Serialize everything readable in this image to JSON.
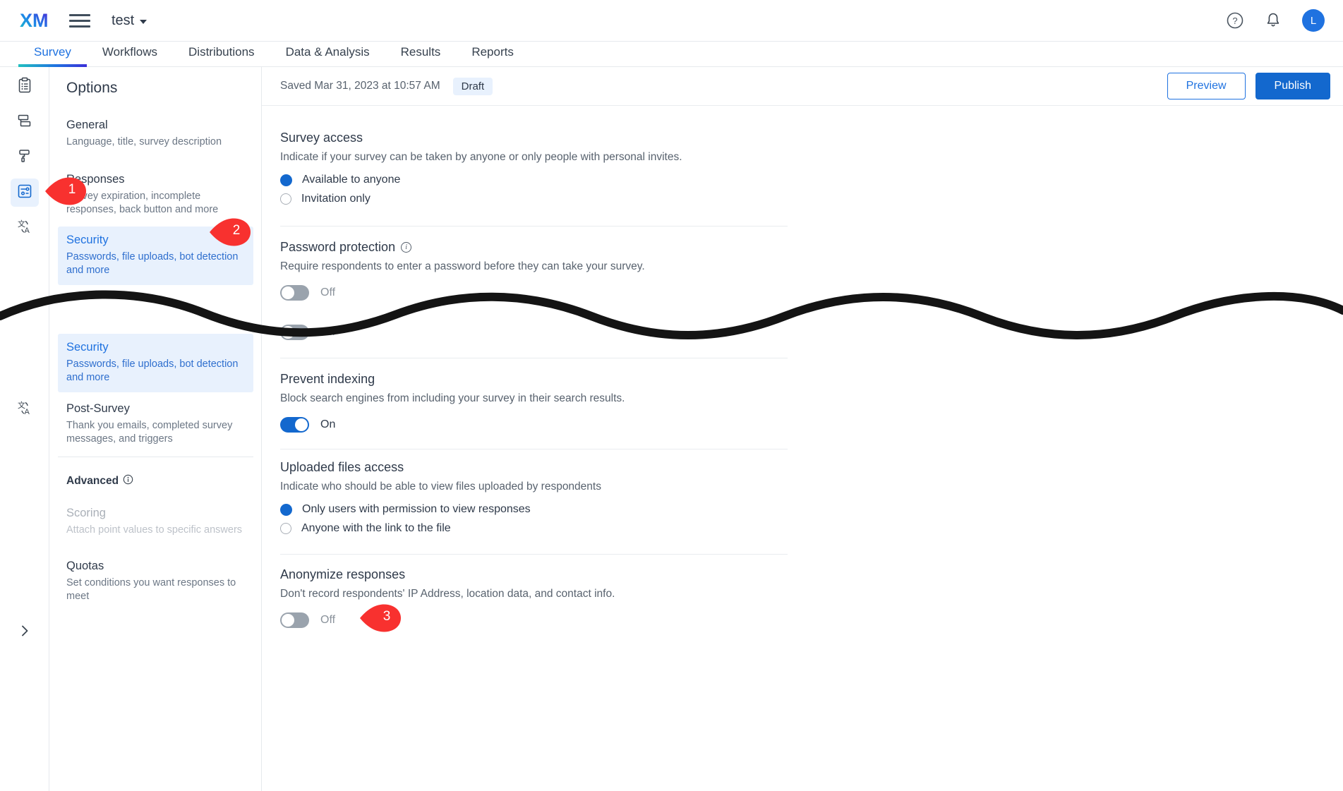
{
  "topbar": {
    "logo": "XM",
    "menu_icon": "hamburger-icon",
    "project_name": "test",
    "help_icon": "question-circle-icon",
    "notifications_icon": "bell-icon",
    "avatar_initial": "L"
  },
  "tabs": [
    {
      "label": "Survey",
      "active": true
    },
    {
      "label": "Workflows",
      "active": false
    },
    {
      "label": "Distributions",
      "active": false
    },
    {
      "label": "Data & Analysis",
      "active": false
    },
    {
      "label": "Results",
      "active": false
    },
    {
      "label": "Reports",
      "active": false
    }
  ],
  "rail": {
    "items": [
      {
        "icon": "clipboard-list-icon",
        "selected": false
      },
      {
        "icon": "flow-blocks-icon",
        "selected": false
      },
      {
        "icon": "paint-roller-icon",
        "selected": false
      },
      {
        "icon": "sliders-options-icon",
        "selected": true
      },
      {
        "icon": "translate-icon",
        "selected": false
      }
    ],
    "expand_icon": "chevron-right-icon"
  },
  "options_panel": {
    "title": "Options",
    "items": [
      {
        "title": "General",
        "subtitle": "Language, title, survey description",
        "selected": false,
        "disabled": false
      },
      {
        "title": "Responses",
        "subtitle": "Survey expiration, incomplete responses, back button and more",
        "selected": false,
        "disabled": false
      },
      {
        "title": "Security",
        "subtitle": "Passwords, file uploads, bot detection and more",
        "selected": true,
        "disabled": false
      },
      {
        "title": "Security",
        "subtitle": "Passwords, file uploads, bot detection and more",
        "selected": true,
        "disabled": false
      },
      {
        "title": "Post-Survey",
        "subtitle": "Thank you emails, completed survey messages, and triggers",
        "selected": false,
        "disabled": false
      }
    ],
    "advanced_label": "Advanced",
    "advanced_info_icon": "info-circle-icon",
    "advanced_items": [
      {
        "title": "Scoring",
        "subtitle": "Attach point values to specific answers",
        "selected": false,
        "disabled": true
      },
      {
        "title": "Quotas",
        "subtitle": "Set conditions you want responses to meet",
        "selected": false,
        "disabled": false
      }
    ]
  },
  "main": {
    "saved_text": "Saved Mar 31, 2023 at 10:57 AM",
    "status_badge": "Draft",
    "preview_button": "Preview",
    "publish_button": "Publish",
    "sections": {
      "survey_access": {
        "title": "Survey access",
        "subtitle": "Indicate if your survey can be taken by anyone or only people with personal invites.",
        "options": [
          {
            "label": "Available to anyone",
            "selected": true
          },
          {
            "label": "Invitation only",
            "selected": false
          }
        ]
      },
      "password_protection": {
        "title": "Password protection",
        "info_icon": "info-circle-icon",
        "subtitle": "Require respondents to enter a password before they can take your survey.",
        "toggle_state": "Off",
        "toggle_on": false
      },
      "hidden_toggle": {
        "toggle_state": "Off",
        "toggle_on": false
      },
      "prevent_indexing": {
        "title": "Prevent indexing",
        "subtitle": "Block search engines from including your survey in their search results.",
        "toggle_state": "On",
        "toggle_on": true
      },
      "uploaded_files_access": {
        "title": "Uploaded files access",
        "subtitle": "Indicate who should be able to view files uploaded by respondents",
        "options": [
          {
            "label": "Only users with permission to view responses",
            "selected": true
          },
          {
            "label": "Anyone with the link to the file",
            "selected": false
          }
        ]
      },
      "anonymize_responses": {
        "title": "Anonymize responses",
        "subtitle": "Don't record respondents' IP Address, location data, and contact info.",
        "toggle_state": "Off",
        "toggle_on": false
      }
    }
  },
  "annotations": {
    "color": "#f8312f",
    "markers": [
      {
        "number": "1"
      },
      {
        "number": "2"
      },
      {
        "number": "3"
      }
    ]
  }
}
